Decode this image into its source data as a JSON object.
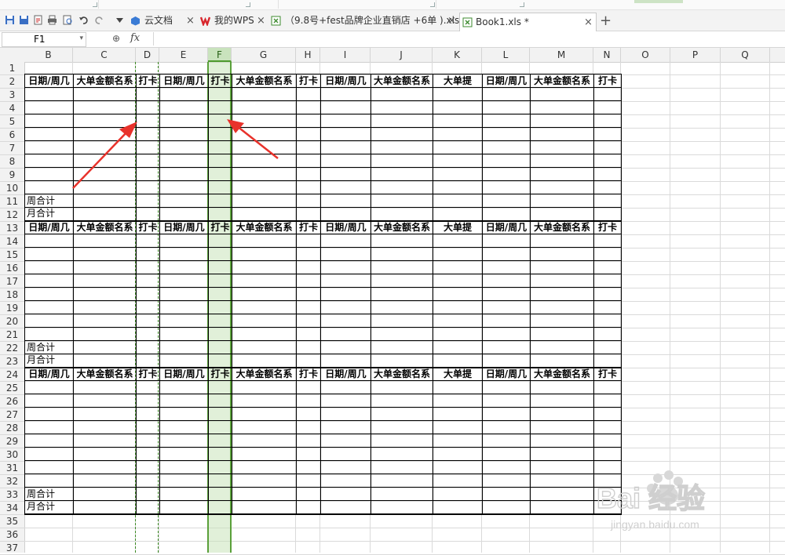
{
  "tabs": [
    {
      "label": "云文档",
      "close": "×"
    },
    {
      "label": "我的WPS",
      "close": "×"
    },
    {
      "label": "（9.8号+fest品牌企业直销店 +6单 ).xls *",
      "close": "×"
    },
    {
      "label": "Book1.xls *",
      "close": "×"
    }
  ],
  "new_tab": "+",
  "formula_bar": {
    "cell_ref": "F1",
    "fx": "fx",
    "zoom_icon": "⊕"
  },
  "columns": [
    "B",
    "C",
    "D",
    "E",
    "F",
    "G",
    "H",
    "I",
    "J",
    "K",
    "L",
    "M",
    "N",
    "O",
    "P",
    "Q"
  ],
  "selected_column": "F",
  "rows": [
    "1",
    "2",
    "3",
    "4",
    "5",
    "6",
    "7",
    "8",
    "9",
    "10",
    "11",
    "12",
    "13",
    "14",
    "15",
    "16",
    "17",
    "18",
    "19",
    "20",
    "21",
    "22",
    "23",
    "24",
    "25",
    "26",
    "27",
    "28",
    "29",
    "30",
    "31",
    "32",
    "33",
    "34",
    "35",
    "36",
    "37"
  ],
  "header_row": [
    "日期/周几",
    "大单金额名系",
    "打卡",
    "日期/周几",
    "打卡",
    "大单金额名系",
    "打卡",
    "日期/周几",
    "大单金额名系",
    "大单提",
    "日期/周几",
    "大单金额名系",
    "打卡"
  ],
  "summary": {
    "weekly": "周合计",
    "monthly": "月合计"
  },
  "watermark": {
    "text": "Bai 经验",
    "url": "jingyan.baidu.com"
  },
  "colors": {
    "selection": "#c9e3bd",
    "selection_border": "#5aa03a",
    "arrow": "#e8322b"
  }
}
